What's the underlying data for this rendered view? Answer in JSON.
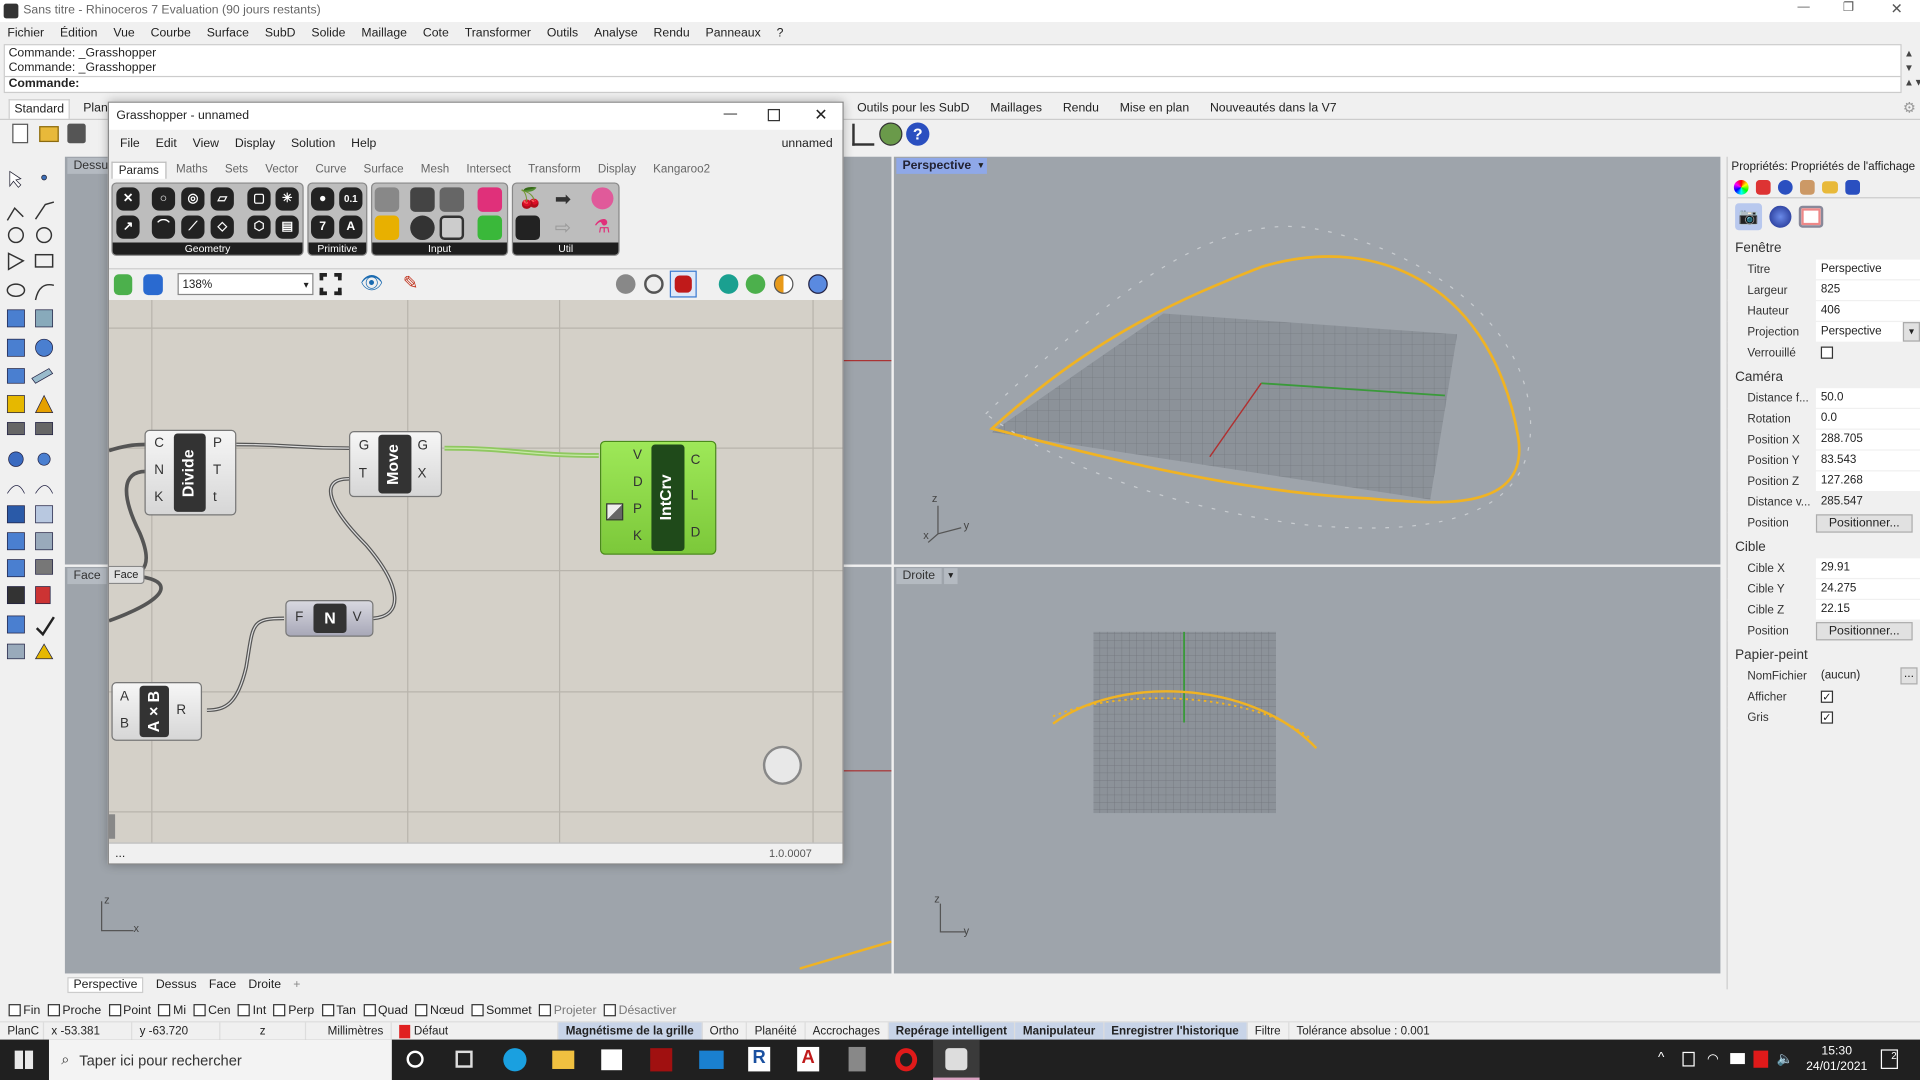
{
  "app": {
    "title": "Sans titre - Rhinoceros 7 Evaluation (90 jours restants)",
    "menu": [
      "Fichier",
      "Édition",
      "Vue",
      "Courbe",
      "Surface",
      "SubD",
      "Solide",
      "Maillage",
      "Cote",
      "Transformer",
      "Outils",
      "Analyse",
      "Rendu",
      "Panneaux",
      "?"
    ]
  },
  "command": {
    "history": [
      "Commande: _Grasshopper",
      "Commande: _Grasshopper"
    ],
    "prompt": "Commande:"
  },
  "toolbar_tabs": [
    "Standard",
    "Plan",
    "Outils pour les SubD",
    "Maillages",
    "Rendu",
    "Mise en plan",
    "Nouveautés dans la V7"
  ],
  "viewports": {
    "top_left": "Dessu",
    "bottom_left": "Face",
    "perspective": "Perspective",
    "right": "Droite",
    "tabs": [
      "Perspective",
      "Dessus",
      "Face",
      "Droite",
      "+"
    ],
    "axis_labels": {
      "x": "x",
      "y": "y",
      "z": "z"
    },
    "accent": "#f0b323"
  },
  "grasshopper": {
    "title": "Grasshopper - unnamed",
    "menu": [
      "File",
      "Edit",
      "View",
      "Display",
      "Solution",
      "Help"
    ],
    "doc_name": "unnamed",
    "tabs": [
      "Params",
      "Maths",
      "Sets",
      "Vector",
      "Curve",
      "Surface",
      "Mesh",
      "Intersect",
      "Transform",
      "Display",
      "Kangaroo2"
    ],
    "active_tab": "Params",
    "groups": [
      "Geometry",
      "Primitive",
      "Input",
      "Util"
    ],
    "primitive_icons": [
      "0.1",
      "7",
      "A"
    ],
    "zoom": "138%",
    "version": "1.0.0007",
    "status_left": "...",
    "components": {
      "divide": {
        "name": "Divide",
        "inputs": [
          "C",
          "N",
          "K"
        ],
        "outputs": [
          "P",
          "T",
          "t"
        ]
      },
      "move": {
        "name": "Move",
        "inputs": [
          "G",
          "T"
        ],
        "outputs": [
          "G",
          "X"
        ]
      },
      "intcrv": {
        "name": "IntCrv",
        "inputs": [
          "V",
          "D",
          "P",
          "K"
        ],
        "outputs": [
          "C",
          "L",
          "D"
        ]
      },
      "normal": {
        "name": "N",
        "inputs": [
          "F"
        ],
        "outputs": [
          "V"
        ]
      },
      "multiply": {
        "name": "A×B",
        "inputs": [
          "A",
          "B"
        ],
        "outputs": [
          "R"
        ]
      },
      "face_param": "Face"
    },
    "intcrv_color": "#8fdc3c"
  },
  "properties": {
    "header": "Propriétés: Propriétés de l'affichage",
    "sections": {
      "window": {
        "title": "Fenêtre",
        "rows": [
          [
            "Titre",
            "Perspective"
          ],
          [
            "Largeur",
            "825"
          ],
          [
            "Hauteur",
            "406"
          ],
          [
            "Projection",
            "Perspective"
          ]
        ],
        "locked_label": "Verrouillé",
        "locked": false
      },
      "camera": {
        "title": "Caméra",
        "rows": [
          [
            "Distance f...",
            "50.0"
          ],
          [
            "Rotation",
            "0.0"
          ],
          [
            "Position X",
            "288.705"
          ],
          [
            "Position Y",
            "83.543"
          ],
          [
            "Position Z",
            "127.268"
          ],
          [
            "Distance v...",
            "285.547"
          ]
        ],
        "position_label": "Position",
        "position_button": "Positionner..."
      },
      "target": {
        "title": "Cible",
        "rows": [
          [
            "Cible X",
            "29.91"
          ],
          [
            "Cible Y",
            "24.275"
          ],
          [
            "Cible Z",
            "22.15"
          ]
        ],
        "position_label": "Position",
        "position_button": "Positionner..."
      },
      "wallpaper": {
        "title": "Papier-peint",
        "file_label": "NomFichier",
        "file_value": "(aucun)",
        "browse": "...",
        "show_label": "Afficher",
        "show": true,
        "gray_label": "Gris",
        "gray": true
      }
    }
  },
  "osnaps": [
    {
      "label": "Fin",
      "on": false
    },
    {
      "label": "Proche",
      "on": false
    },
    {
      "label": "Point",
      "on": false
    },
    {
      "label": "Mi",
      "on": false
    },
    {
      "label": "Cen",
      "on": false
    },
    {
      "label": "Int",
      "on": false
    },
    {
      "label": "Perp",
      "on": false
    },
    {
      "label": "Tan",
      "on": false
    },
    {
      "label": "Quad",
      "on": false
    },
    {
      "label": "Nœud",
      "on": false
    },
    {
      "label": "Sommet",
      "on": false
    },
    {
      "label": "Projeter",
      "on": false
    },
    {
      "label": "Désactiver",
      "on": false
    }
  ],
  "statusbar": {
    "plane": "PlanC",
    "x": "x -53.381",
    "y": "y -63.720",
    "z": "z",
    "units": "Millimètres",
    "layer": "Défaut",
    "layer_color": "#e02020",
    "toggles": [
      {
        "label": "Magnétisme de la grille",
        "on": true
      },
      {
        "label": "Ortho",
        "on": false
      },
      {
        "label": "Planéité",
        "on": false
      },
      {
        "label": "Accrochages",
        "on": false
      },
      {
        "label": "Repérage intelligent",
        "on": true
      },
      {
        "label": "Manipulateur",
        "on": true
      },
      {
        "label": "Enregistrer l'historique",
        "on": true
      },
      {
        "label": "Filtre",
        "on": false
      }
    ],
    "tolerance": "Tolérance absolue : 0.001"
  },
  "taskbar": {
    "search_placeholder": "Taper ici pour rechercher",
    "time": "15:30",
    "date": "24/01/2021",
    "notifications": "2"
  }
}
